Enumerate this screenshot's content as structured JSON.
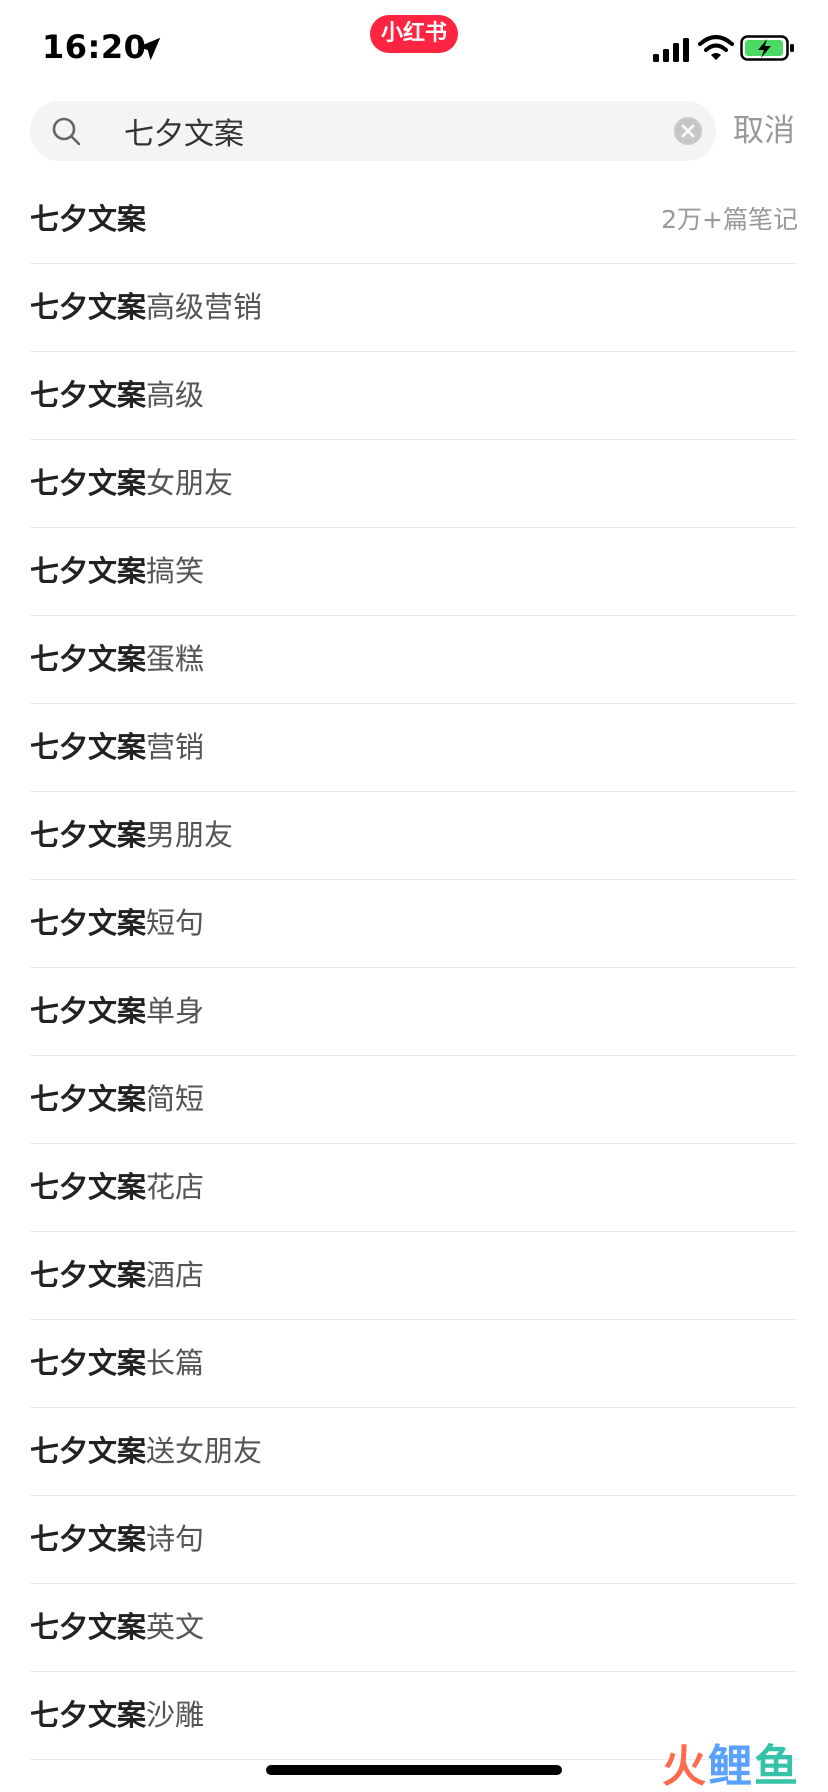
{
  "status_bar": {
    "time": "16:20",
    "app_badge": "小红书",
    "icons": [
      "location-arrow-icon",
      "cellular-signal-icon",
      "wifi-icon",
      "battery-charging-icon"
    ]
  },
  "search": {
    "query": "七夕文案",
    "clear_icon": "clear-icon",
    "cancel_label": "取消"
  },
  "suggestions": [
    {
      "keyword": "七夕文案",
      "suffix": "",
      "count": "2万+篇笔记"
    },
    {
      "keyword": "七夕文案",
      "suffix": "高级营销"
    },
    {
      "keyword": "七夕文案",
      "suffix": "高级"
    },
    {
      "keyword": "七夕文案",
      "suffix": "女朋友"
    },
    {
      "keyword": "七夕文案",
      "suffix": "搞笑"
    },
    {
      "keyword": "七夕文案",
      "suffix": "蛋糕"
    },
    {
      "keyword": "七夕文案",
      "suffix": "营销"
    },
    {
      "keyword": "七夕文案",
      "suffix": "男朋友"
    },
    {
      "keyword": "七夕文案",
      "suffix": "短句"
    },
    {
      "keyword": "七夕文案",
      "suffix": "单身"
    },
    {
      "keyword": "七夕文案",
      "suffix": "简短"
    },
    {
      "keyword": "七夕文案",
      "suffix": "花店"
    },
    {
      "keyword": "七夕文案",
      "suffix": "酒店"
    },
    {
      "keyword": "七夕文案",
      "suffix": "长篇"
    },
    {
      "keyword": "七夕文案",
      "suffix": "送女朋友"
    },
    {
      "keyword": "七夕文案",
      "suffix": "诗句"
    },
    {
      "keyword": "七夕文案",
      "suffix": "英文"
    },
    {
      "keyword": "七夕文案",
      "suffix": "沙雕"
    }
  ],
  "watermark": {
    "part1": "火",
    "part2": "鲤",
    "part3": "鱼"
  },
  "colors": {
    "brand": "#ff2442",
    "muted": "#999999",
    "divider": "#ebebeb"
  }
}
